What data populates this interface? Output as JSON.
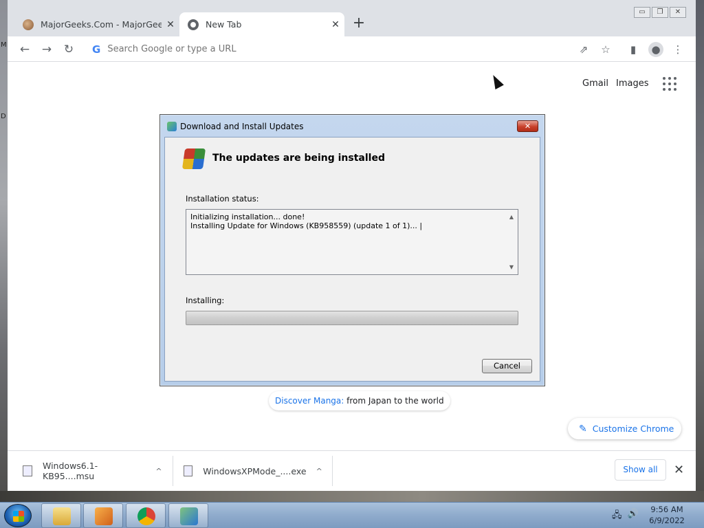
{
  "browser": {
    "tabs": [
      {
        "title": "MajorGeeks.Com - MajorGeeks",
        "close": "✕"
      },
      {
        "title": "New Tab",
        "close": "✕"
      }
    ],
    "new_tab": "+",
    "window_buttons": {
      "minimize": "▭",
      "restore": "❐",
      "close": "✕"
    },
    "nav": {
      "back": "←",
      "forward": "→",
      "reload": "↻"
    },
    "omnibox": {
      "logo": "G",
      "placeholder": "Search Google or type a URL"
    },
    "toolbar_icons": {
      "share": "⇗",
      "bookmark": "☆",
      "side_panel": "▮",
      "profile": "●",
      "menu": "⋮"
    }
  },
  "ntp": {
    "links": [
      "Gmail",
      "Images"
    ],
    "shortcut": {
      "highlight": "Discover Manga:",
      "rest": "from Japan to the world"
    },
    "customize": {
      "icon": "✎",
      "label": "Customize Chrome"
    }
  },
  "downloads": {
    "items": [
      {
        "name": "Windows6.1-KB95....msu",
        "caret": "^"
      },
      {
        "name": "WindowsXPMode_....exe",
        "caret": "^"
      }
    ],
    "show_all": "Show all",
    "close": "✕"
  },
  "dialog": {
    "title": "Download and Install Updates",
    "close": "✕",
    "heading": "The updates are being installed",
    "status_label": "Installation status:",
    "status_lines": [
      "Initializing installation... done!",
      "Installing Update for Windows (KB958559) (update 1 of 1)... |"
    ],
    "scroll_up": "▲",
    "scroll_down": "▼",
    "progress_label": "Installing:",
    "progress_fraction": 0.0,
    "cancel": "Cancel"
  },
  "taskbar": {
    "time": "9:56 AM",
    "date": "6/9/2022",
    "tray_icons": {
      "network": "🖧",
      "volume": "🔊"
    }
  },
  "desktop": {
    "edge_letters": [
      "M",
      "D"
    ]
  }
}
